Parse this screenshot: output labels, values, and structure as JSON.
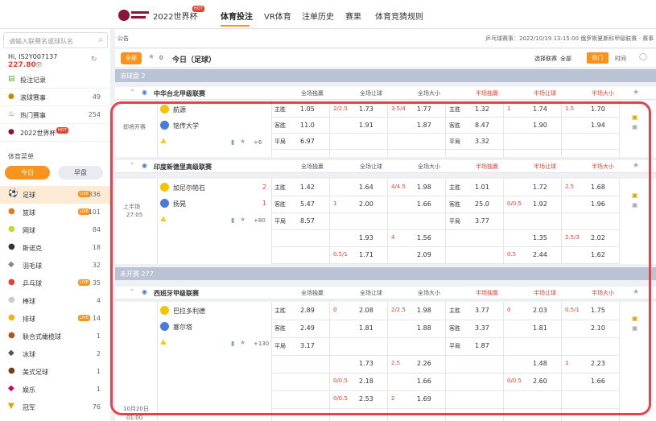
{
  "nav": {
    "wc": "2022世界杯",
    "hot": "HOT",
    "tabs": [
      "体育投注",
      "VR体育",
      "注单历史",
      "赛果",
      "体育竞猜规则"
    ]
  },
  "sidebar": {
    "search_placeholder": "请输入联赛名或球队名",
    "user": "Hi, IS2Y007137",
    "balance": "227.80",
    "menu": [
      {
        "label": "投注记录",
        "count": ""
      },
      {
        "label": "滚球赛事",
        "count": "49"
      },
      {
        "label": "热门赛事",
        "count": "254"
      },
      {
        "label": "2022世界杯",
        "count": ""
      }
    ],
    "section": "体育菜单",
    "today": "今日",
    "early": "早盘",
    "sports": [
      {
        "label": "足球",
        "count": "336",
        "live": true
      },
      {
        "label": "篮球",
        "count": "101",
        "live": true
      },
      {
        "label": "网球",
        "count": "84",
        "live": false
      },
      {
        "label": "斯诺克",
        "count": "18",
        "live": false
      },
      {
        "label": "羽毛球",
        "count": "32",
        "live": false
      },
      {
        "label": "乒乓球",
        "count": "35",
        "live": true
      },
      {
        "label": "棒球",
        "count": "4",
        "live": false
      },
      {
        "label": "排球",
        "count": "14",
        "live": true
      },
      {
        "label": "联合式橄榄球",
        "count": "1",
        "live": false
      },
      {
        "label": "冰球",
        "count": "2",
        "live": false
      },
      {
        "label": "美式足球",
        "count": "1",
        "live": false
      },
      {
        "label": "娱乐",
        "count": "1",
        "live": false
      },
      {
        "label": "冠军",
        "count": "76",
        "live": false
      }
    ],
    "live_tag": "LIVE"
  },
  "notice": {
    "label": "公告",
    "text": "乒乓球赛事：2022/10/19 13:15:00 俄罗斯夏斯科甲级联赛 - 赛事"
  },
  "toolbar": {
    "all": "全部",
    "star": "0",
    "title": "今日（足球）",
    "select": "选择联赛",
    "select_val": "全部",
    "hot": "热门",
    "time": "时间"
  },
  "sections": {
    "live": "滚球盘  2",
    "pre": "未开赛  277"
  },
  "cols": [
    "全场独赢",
    "全场让球",
    "全场大小",
    "半场独赢",
    "半场让球",
    "半场大小"
  ],
  "leagues": [
    "中华台北甲级联赛",
    "印度新德里高级联赛",
    "西班牙甲级联赛"
  ],
  "m1": {
    "status": "即将开赛",
    "home": "航源",
    "away": "铭传大学",
    "more": "+6",
    "r": [
      [
        "主胜",
        "1.05",
        "2/2.5",
        "1.73",
        "3.5/4",
        "1.77",
        "主胜",
        "1.32",
        "1",
        "1.74",
        "1.5",
        "1.70"
      ],
      [
        "客胜",
        "11.0",
        "",
        "1.91",
        "",
        "1.87",
        "客胜",
        "8.47",
        "",
        "1.90",
        "",
        "1.94"
      ],
      [
        "平局",
        "6.97",
        "",
        "",
        "",
        "",
        "平局",
        "3.32",
        "",
        "",
        "",
        ""
      ]
    ]
  },
  "m2": {
    "status": "上半场",
    "time": "27:05",
    "home": "加尼尔帕石",
    "away": "扬晃",
    "hs": "2",
    "as": "1",
    "more": "+80",
    "r": [
      [
        "主胜",
        "1.42",
        "",
        "1.64",
        "4/4.5",
        "1.98",
        "主胜",
        "1.01",
        "",
        "1.72",
        "2.5",
        "1.68"
      ],
      [
        "客胜",
        "5.47",
        "1",
        "2.00",
        "",
        "1.66",
        "客胜",
        "25.0",
        "0/0.5",
        "1.92",
        "",
        "1.96"
      ],
      [
        "平局",
        "8.57",
        "",
        "",
        "",
        "",
        "平局",
        "3.77",
        "",
        "",
        "",
        ""
      ],
      [
        "",
        "",
        "",
        "1.93",
        "4",
        "1.56",
        "",
        "",
        "",
        "1.35",
        "2.5/3",
        "2.02"
      ],
      [
        "",
        "",
        "0.5/1",
        "1.71",
        "",
        "2.09",
        "",
        "",
        "0.5",
        "2.44",
        "",
        "1.62"
      ]
    ]
  },
  "m3": {
    "date": "10月20日",
    "time": "01:00",
    "home": "巴拉多利德",
    "away": "塞尔塔",
    "more": "+130",
    "r": [
      [
        "主胜",
        "2.89",
        "0",
        "2.08",
        "2/2.5",
        "1.98",
        "主胜",
        "3.77",
        "0",
        "2.03",
        "0.5/1",
        "1.75"
      ],
      [
        "客胜",
        "2.49",
        "",
        "1.81",
        "",
        "1.88",
        "客胜",
        "3.37",
        "",
        "1.81",
        "",
        "2.10"
      ],
      [
        "平局",
        "3.17",
        "",
        "",
        "",
        "",
        "平局",
        "1.87",
        "",
        "",
        "",
        ""
      ],
      [
        "",
        "",
        "",
        "1.73",
        "2.5",
        "2.26",
        "",
        "",
        "",
        "1.48",
        "1",
        "2.23"
      ],
      [
        "",
        "",
        "0/0.5",
        "2.18",
        "",
        "1.66",
        "",
        "",
        "0/0.5",
        "2.60",
        "",
        "1.66"
      ],
      [
        "",
        "",
        "0/0.5",
        "2.53",
        "2",
        "1.69",
        "",
        "",
        "",
        "",
        "",
        ""
      ]
    ]
  }
}
